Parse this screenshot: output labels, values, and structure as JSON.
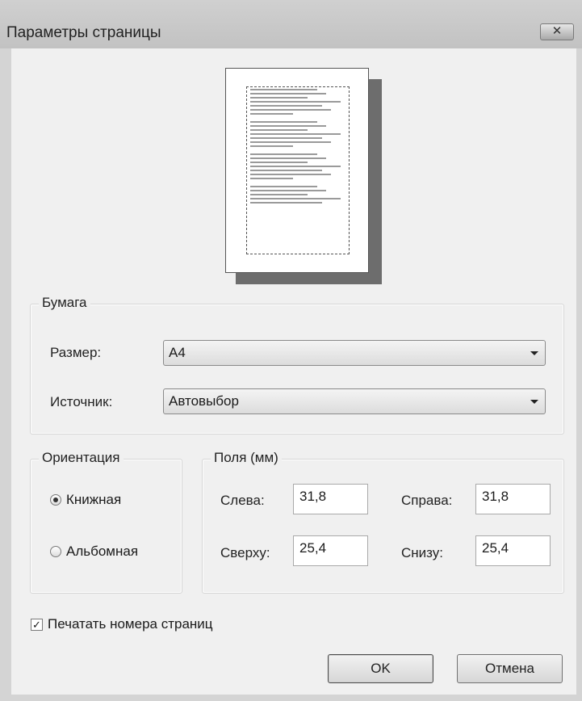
{
  "window": {
    "title": "Параметры страницы",
    "close_glyph": "✕"
  },
  "paper": {
    "group_label": "Бумага",
    "size_label": "Размер:",
    "size_value": "A4",
    "source_label": "Источник:",
    "source_value": "Автовыбор"
  },
  "orientation": {
    "group_label": "Ориентация",
    "portrait_label": "Книжная",
    "landscape_label": "Альбомная",
    "selected": "portrait"
  },
  "margins": {
    "group_label": "Поля (мм)",
    "left_label": "Слева:",
    "left_value": "31,8",
    "right_label": "Справа:",
    "right_value": "31,8",
    "top_label": "Сверху:",
    "top_value": "25,4",
    "bottom_label": "Снизу:",
    "bottom_value": "25,4"
  },
  "print_page_numbers": {
    "label": "Печатать номера страниц",
    "checked": true
  },
  "buttons": {
    "ok": "OK",
    "cancel": "Отмена"
  }
}
